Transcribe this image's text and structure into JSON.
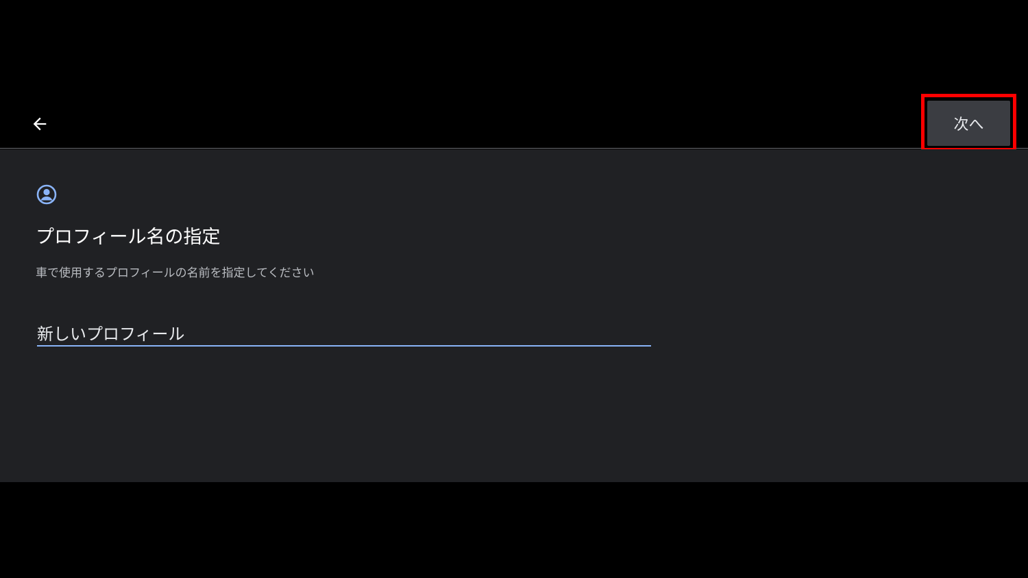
{
  "toolbar": {
    "back_icon": "arrow-left-icon",
    "next_label": "次へ",
    "highlight_color": "#ff0000"
  },
  "content": {
    "profile_icon": "account-circle-icon",
    "title": "プロフィール名の指定",
    "subtitle": "車で使用するプロフィールの名前を指定してください",
    "name_input_value": "新しいプロフィール",
    "accent_color": "#8ab4f8"
  }
}
